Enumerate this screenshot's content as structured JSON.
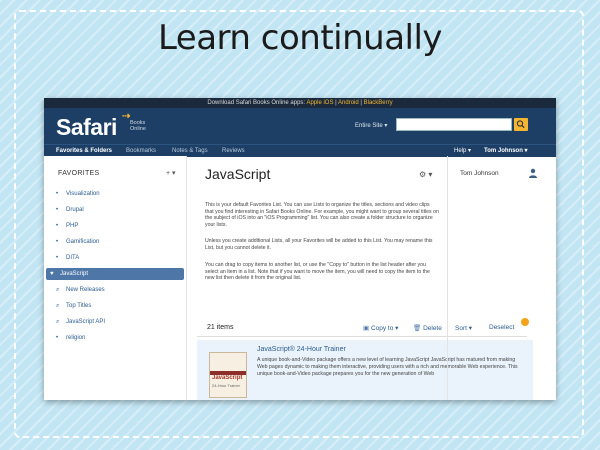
{
  "slide": {
    "title": "Learn continually",
    "colors": {
      "background": "#c2e5f4",
      "border": "#ffffff"
    }
  },
  "app": {
    "download_bar": {
      "prefix": "Download Safari Books Online apps:",
      "ios": "Apple iOS",
      "sep1": "|",
      "android": "Android",
      "sep2": "|",
      "blackberry": "BlackBerry"
    },
    "header": {
      "logo": "Safari",
      "logo_sub_1": "Books",
      "logo_sub_2": "Online",
      "search_scope": "Entire Site ▾",
      "search_value": "",
      "search_icon": "magnifier-icon",
      "colors": {
        "header": "#1d3f66",
        "accent": "#f2b632"
      }
    },
    "nav": {
      "tabs": [
        "Favorites & Folders",
        "Bookmarks",
        "Notes & Tags",
        "Reviews"
      ],
      "help": "Help ▾",
      "user_menu": "Tom Johnson ▾"
    },
    "sidebar": {
      "heading": "FAVORITES",
      "add": "+ ▾",
      "items": [
        {
          "label": "Visualization",
          "marker": "•"
        },
        {
          "label": "Drupal",
          "marker": "•"
        },
        {
          "label": "PHP",
          "marker": "•"
        },
        {
          "label": "Gamification",
          "marker": "•"
        },
        {
          "label": "DITA",
          "marker": "•"
        },
        {
          "label": "JavaScript",
          "marker": "♥",
          "selected": true
        },
        {
          "label": "New Releases",
          "marker": "⌕"
        },
        {
          "label": "Top Titles",
          "marker": "⌕"
        },
        {
          "label": "JavaScript API",
          "marker": "⌕"
        },
        {
          "label": "religion",
          "marker": "•"
        }
      ]
    },
    "main": {
      "title": "JavaScript",
      "gear": "⚙ ▾",
      "paragraphs": [
        "This is your default Favorites List. You can use Lists to organize the titles, sections and video clips that you find interesting in Safari Books Online. For example, you might want to group several titles on the subject of iOS into an \"iOS Programming\" list. You can also create a folder structure to organize your lists.",
        "Unless you create additional Lists, all your Favorites will be added to this List. You may rename this List, but you cannot delete it.",
        "You can drag to copy items to another list, or use the \"Copy to\" button in the list header after you select an item in a list. Note that if you want to move the item, you will need to copy the item to the new list then delete it from the original list."
      ],
      "items_count": "21 items",
      "actions": {
        "copy": "Copy to ▾",
        "delete": "Delete",
        "sort": "Sort ▾",
        "deselect": "Deselect"
      },
      "book": {
        "title": "JavaScript® 24-Hour Trainer",
        "cover_text": "JavaScript",
        "cover_sub": "24-Hour Trainer",
        "description": "A unique book-and-Video package offers a new level of learning JavaScript JavaScript has matured from making Web pages dynamic to making them interactive, providing users with a rich and memorable Web experience. This unique book-and-Video package prepares you for the new generation of Web"
      }
    },
    "right": {
      "user_name": "Tom Johnson",
      "user_icon": "person-icon"
    }
  }
}
